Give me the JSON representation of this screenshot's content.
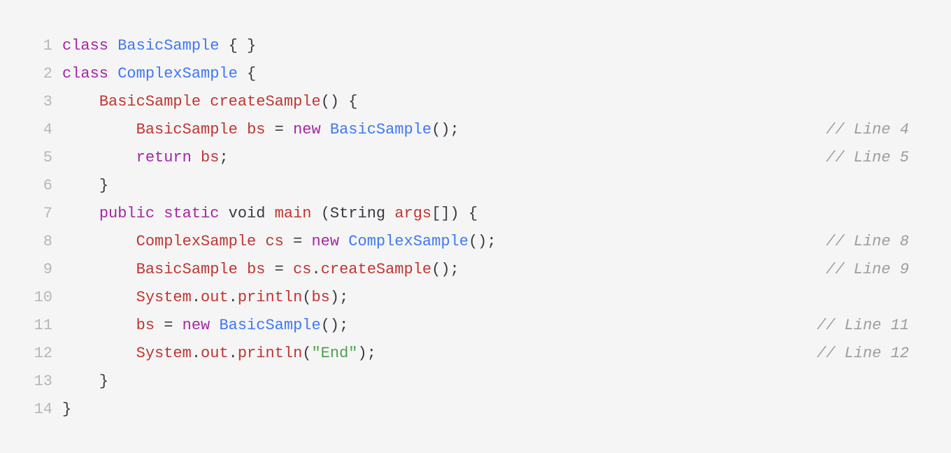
{
  "code": {
    "lines": [
      {
        "num": "1",
        "indent": "",
        "tokens": [
          {
            "t": "class ",
            "c": "kw"
          },
          {
            "t": "BasicSample",
            "c": "type"
          },
          {
            "t": " { }",
            "c": "pn"
          }
        ],
        "comment": ""
      },
      {
        "num": "2",
        "indent": "",
        "tokens": [
          {
            "t": "class ",
            "c": "kw"
          },
          {
            "t": "ComplexSample",
            "c": "type"
          },
          {
            "t": " {",
            "c": "pn"
          }
        ],
        "comment": ""
      },
      {
        "num": "3",
        "indent": "    ",
        "tokens": [
          {
            "t": "BasicSample ",
            "c": "name"
          },
          {
            "t": "createSample",
            "c": "fn"
          },
          {
            "t": "() {",
            "c": "pn"
          }
        ],
        "comment": ""
      },
      {
        "num": "4",
        "indent": "        ",
        "tokens": [
          {
            "t": "BasicSample ",
            "c": "name"
          },
          {
            "t": "bs ",
            "c": "name"
          },
          {
            "t": "= ",
            "c": "pn"
          },
          {
            "t": "new ",
            "c": "kw"
          },
          {
            "t": "BasicSample",
            "c": "type"
          },
          {
            "t": "();",
            "c": "pn"
          }
        ],
        "comment": "// Line 4"
      },
      {
        "num": "5",
        "indent": "        ",
        "tokens": [
          {
            "t": "return ",
            "c": "kw"
          },
          {
            "t": "bs",
            "c": "name"
          },
          {
            "t": ";",
            "c": "pn"
          }
        ],
        "comment": "// Line 5"
      },
      {
        "num": "6",
        "indent": "    ",
        "tokens": [
          {
            "t": "}",
            "c": "pn"
          }
        ],
        "comment": ""
      },
      {
        "num": "7",
        "indent": "    ",
        "tokens": [
          {
            "t": "public ",
            "c": "kw"
          },
          {
            "t": "static ",
            "c": "kw"
          },
          {
            "t": "void ",
            "c": "pn"
          },
          {
            "t": "main ",
            "c": "fn"
          },
          {
            "t": "(",
            "c": "pn"
          },
          {
            "t": "String ",
            "c": "pn"
          },
          {
            "t": "args",
            "c": "name"
          },
          {
            "t": "[]) {",
            "c": "pn"
          }
        ],
        "comment": ""
      },
      {
        "num": "8",
        "indent": "        ",
        "tokens": [
          {
            "t": "ComplexSample ",
            "c": "name"
          },
          {
            "t": "cs ",
            "c": "name"
          },
          {
            "t": "= ",
            "c": "pn"
          },
          {
            "t": "new ",
            "c": "kw"
          },
          {
            "t": "ComplexSample",
            "c": "type"
          },
          {
            "t": "();",
            "c": "pn"
          }
        ],
        "comment": "// Line 8"
      },
      {
        "num": "9",
        "indent": "        ",
        "tokens": [
          {
            "t": "BasicSample ",
            "c": "name"
          },
          {
            "t": "bs ",
            "c": "name"
          },
          {
            "t": "= ",
            "c": "pn"
          },
          {
            "t": "cs",
            "c": "name"
          },
          {
            "t": ".",
            "c": "pn"
          },
          {
            "t": "createSample",
            "c": "fn"
          },
          {
            "t": "();",
            "c": "pn"
          }
        ],
        "comment": "// Line 9"
      },
      {
        "num": "10",
        "indent": "        ",
        "tokens": [
          {
            "t": "System",
            "c": "name"
          },
          {
            "t": ".",
            "c": "pn"
          },
          {
            "t": "out",
            "c": "name"
          },
          {
            "t": ".",
            "c": "pn"
          },
          {
            "t": "println",
            "c": "fn"
          },
          {
            "t": "(",
            "c": "pn"
          },
          {
            "t": "bs",
            "c": "name"
          },
          {
            "t": ");",
            "c": "pn"
          }
        ],
        "comment": ""
      },
      {
        "num": "11",
        "indent": "        ",
        "tokens": [
          {
            "t": "bs ",
            "c": "name"
          },
          {
            "t": "= ",
            "c": "pn"
          },
          {
            "t": "new ",
            "c": "kw"
          },
          {
            "t": "BasicSample",
            "c": "type"
          },
          {
            "t": "();",
            "c": "pn"
          }
        ],
        "comment": "// Line 11"
      },
      {
        "num": "12",
        "indent": "        ",
        "tokens": [
          {
            "t": "System",
            "c": "name"
          },
          {
            "t": ".",
            "c": "pn"
          },
          {
            "t": "out",
            "c": "name"
          },
          {
            "t": ".",
            "c": "pn"
          },
          {
            "t": "println",
            "c": "fn"
          },
          {
            "t": "(",
            "c": "pn"
          },
          {
            "t": "\"End\"",
            "c": "str"
          },
          {
            "t": ");",
            "c": "pn"
          }
        ],
        "comment": "// Line 12"
      },
      {
        "num": "13",
        "indent": "    ",
        "tokens": [
          {
            "t": "}",
            "c": "pn"
          }
        ],
        "comment": ""
      },
      {
        "num": "14",
        "indent": "",
        "tokens": [
          {
            "t": "}",
            "c": "pn"
          }
        ],
        "comment": ""
      }
    ]
  }
}
